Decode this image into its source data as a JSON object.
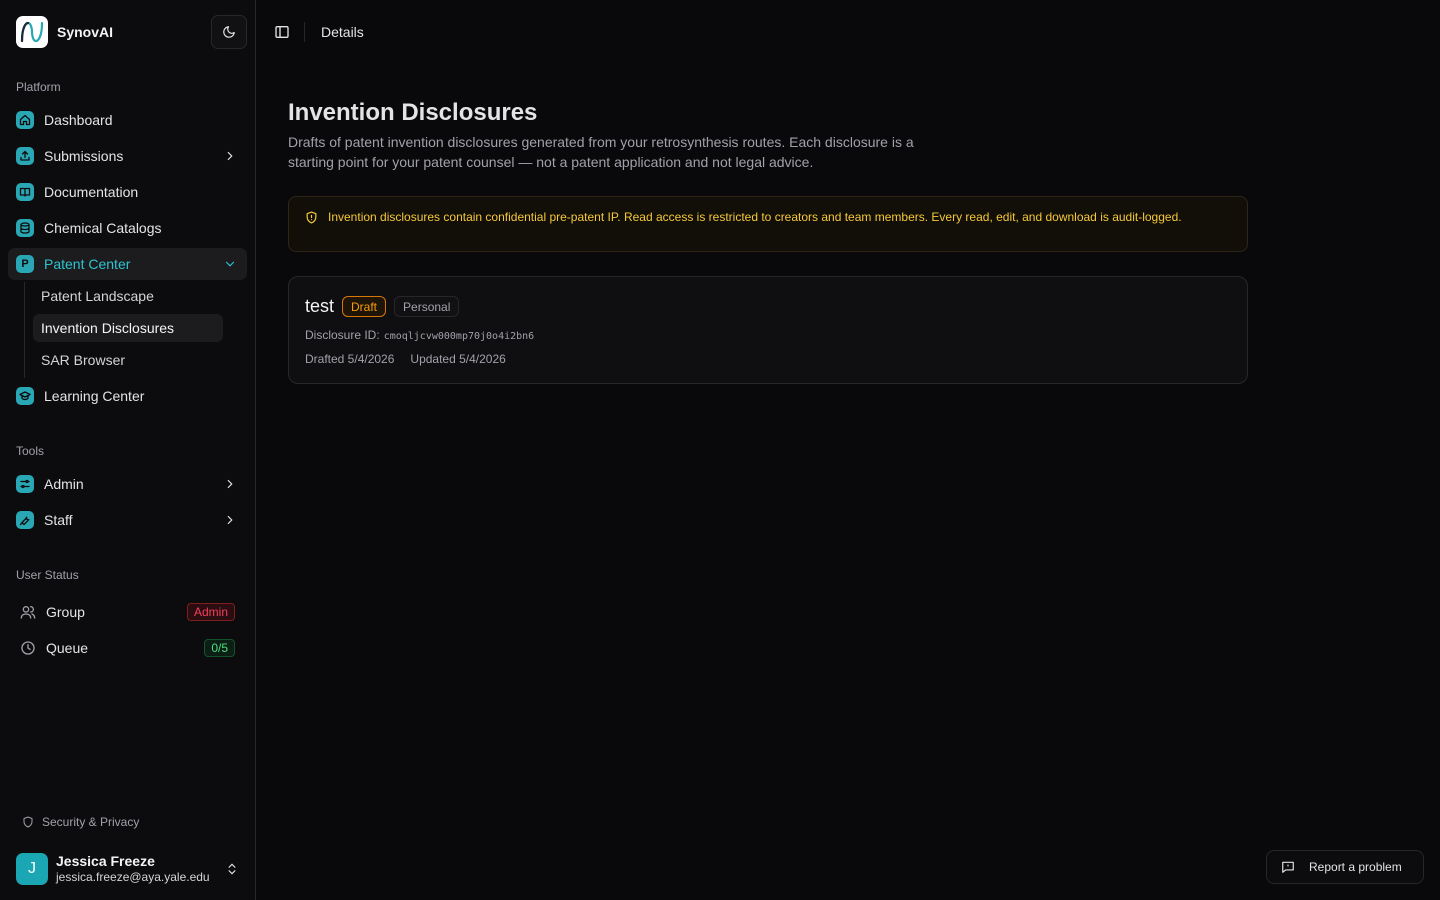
{
  "brand": {
    "name": "SynovAI"
  },
  "sidebar": {
    "platform_label": "Platform",
    "platform_items": [
      {
        "label": "Dashboard",
        "icon": "home-icon"
      },
      {
        "label": "Submissions",
        "icon": "upload-icon"
      },
      {
        "label": "Documentation",
        "icon": "book-icon"
      },
      {
        "label": "Chemical Catalogs",
        "icon": "database-icon"
      },
      {
        "label": "Patent Center",
        "icon": "letter-p-icon",
        "icon_letter": "P"
      },
      {
        "label": "Learning Center",
        "icon": "graduation-cap-icon"
      }
    ],
    "patent_sub_items": [
      "Patent Landscape",
      "Invention Disclosures",
      "SAR Browser"
    ],
    "tools_label": "Tools",
    "tools_items": [
      {
        "label": "Admin",
        "icon": "sliders-icon"
      },
      {
        "label": "Staff",
        "icon": "wrench-icon"
      }
    ],
    "status_label": "User Status",
    "group": {
      "label": "Group",
      "badge": "Admin"
    },
    "queue": {
      "label": "Queue",
      "badge": "0/5"
    },
    "security_link": "Security & Privacy",
    "user": {
      "initial": "J",
      "name": "Jessica Freeze",
      "email": "jessica.freeze@aya.yale.edu"
    }
  },
  "topbar": {
    "breadcrumb": "Details"
  },
  "main": {
    "title": "Invention Disclosures",
    "description": "Drafts of patent invention disclosures generated from your retrosynthesis routes. Each disclosure is a starting point for your patent counsel — not a patent application and not legal advice.",
    "alert": "Invention disclosures contain confidential pre-patent IP. Read access is restricted to creators and team members. Every read, edit, and download is audit-logged.",
    "disclosure": {
      "title": "test",
      "status_badge": "Draft",
      "scope_badge": "Personal",
      "id_label": "Disclosure ID:",
      "id_value": "cmoqljcvw000mp70j0o4i2bn6",
      "drafted": "Drafted 5/4/2026",
      "updated": "Updated 5/4/2026"
    }
  },
  "report_button": "Report a problem",
  "colors": {
    "accent": "#2ec4cf",
    "warning": "#f5c93a",
    "draft": "#f59e0b",
    "admin": "#f43f5e",
    "queue": "#4ade80"
  }
}
